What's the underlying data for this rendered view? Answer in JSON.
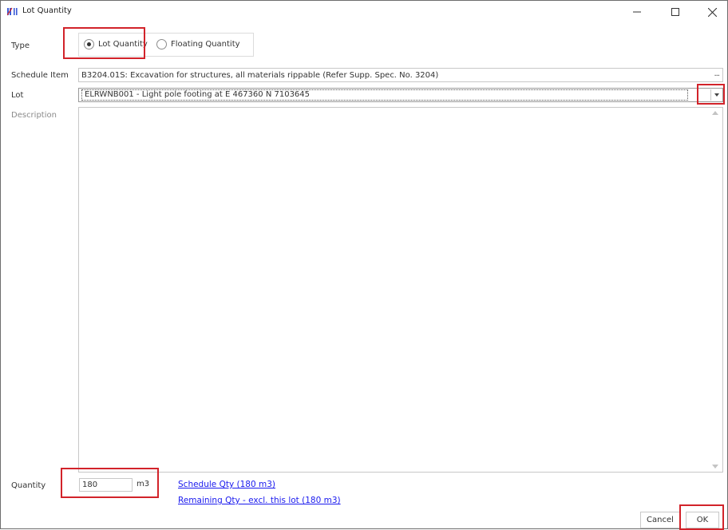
{
  "window": {
    "title": "Lot Quantity",
    "controls": {
      "minimize": "minimize-icon",
      "maximize": "maximize-icon",
      "close": "close-icon"
    }
  },
  "form": {
    "type": {
      "label": "Type",
      "options": [
        {
          "label": "Lot Quantity",
          "selected": true
        },
        {
          "label": "Floating Quantity",
          "selected": false
        }
      ]
    },
    "schedule_item": {
      "label": "Schedule Item",
      "value": "B3204.01S: Excavation for structures, all materials rippable (Refer Supp. Spec. No. 3204)",
      "browse_label": "..."
    },
    "lot": {
      "label": "Lot",
      "value": "ELRWNB001 - Light pole footing at E 467360 N 7103645"
    },
    "description": {
      "label": "Description",
      "value": ""
    },
    "quantity": {
      "label": "Quantity",
      "value": "180",
      "unit": "m3"
    }
  },
  "links": {
    "schedule_qty": "Schedule Qty (180 m3)",
    "remaining_qty": "Remaining Qty - excl. this lot (180 m3)"
  },
  "buttons": {
    "cancel": "Cancel",
    "ok": "OK"
  },
  "colors": {
    "highlight": "#d2232a",
    "link": "#1a1aee",
    "border": "#c8c8c8"
  }
}
